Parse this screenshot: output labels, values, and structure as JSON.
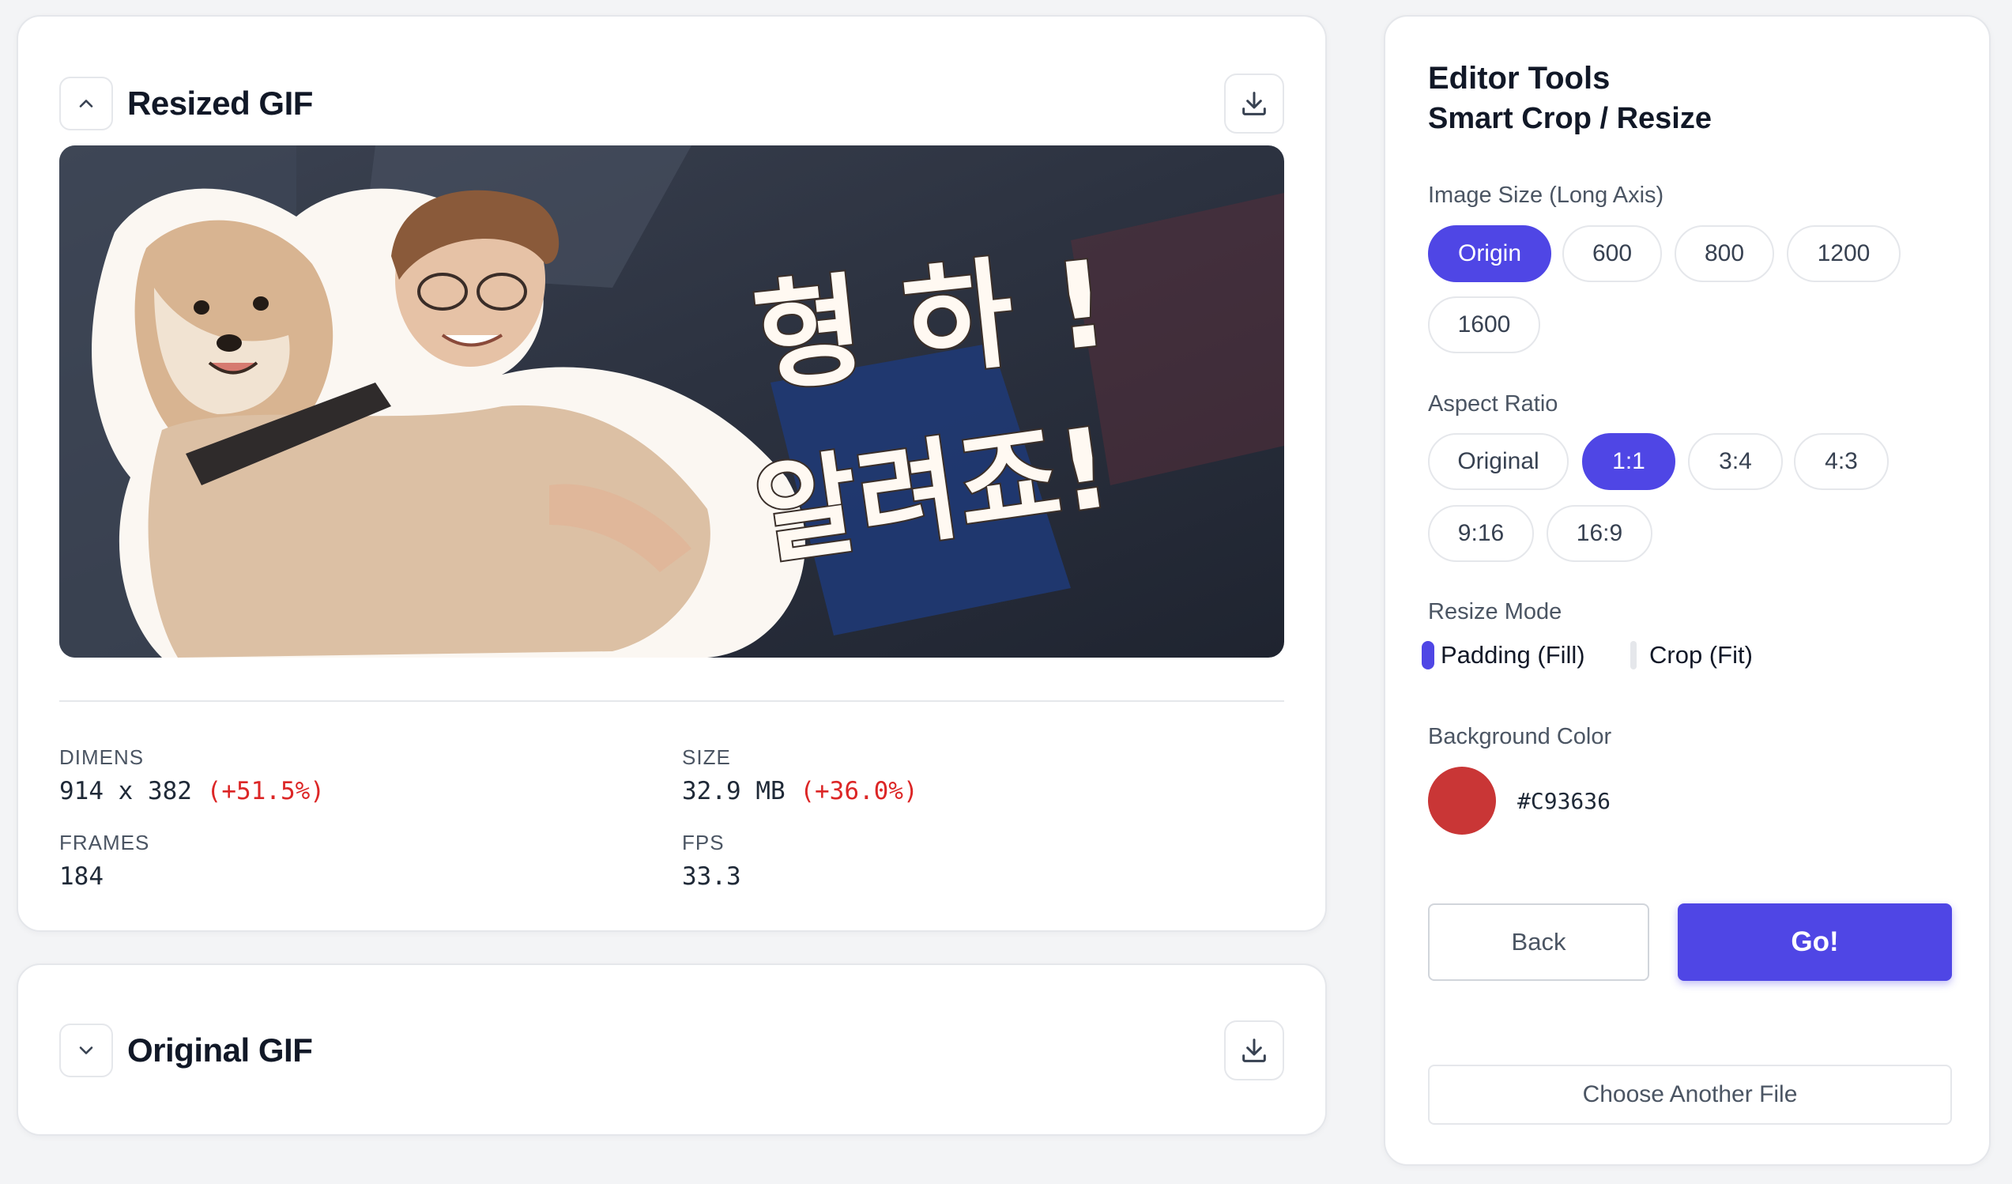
{
  "resized": {
    "title": "Resized GIF",
    "stats": {
      "dimens_label": "DIMENS",
      "dimens_value": "914 x 382",
      "dimens_delta": "(+51.5%)",
      "size_label": "SIZE",
      "size_value": "32.9 MB",
      "size_delta": "(+36.0%)",
      "frames_label": "FRAMES",
      "frames_value": "184",
      "fps_label": "FPS",
      "fps_value": "33.3"
    },
    "preview_text": {
      "line1": "형 하 !",
      "line2": "알려죠!"
    }
  },
  "original": {
    "title": "Original GIF"
  },
  "tools": {
    "title": "Editor Tools",
    "subtitle": "Smart Crop / Resize",
    "image_size_label": "Image Size (Long Axis)",
    "image_sizes": [
      "Origin",
      "600",
      "800",
      "1200",
      "1600"
    ],
    "image_size_selected": "Origin",
    "aspect_label": "Aspect Ratio",
    "aspect_ratios": [
      "Original",
      "1:1",
      "3:4",
      "4:3",
      "9:16",
      "16:9"
    ],
    "aspect_selected": "1:1",
    "resize_mode_label": "Resize Mode",
    "resize_modes": [
      "Padding (Fill)",
      "Crop (Fit)"
    ],
    "resize_mode_selected": "Padding (Fill)",
    "bg_color_label": "Background Color",
    "bg_color_hex": "#C93636",
    "back_label": "Back",
    "go_label": "Go!",
    "choose_file_label": "Choose Another File"
  },
  "colors": {
    "accent": "#4f46e5",
    "delta": "#dc2626",
    "swatch": "#c93636"
  }
}
